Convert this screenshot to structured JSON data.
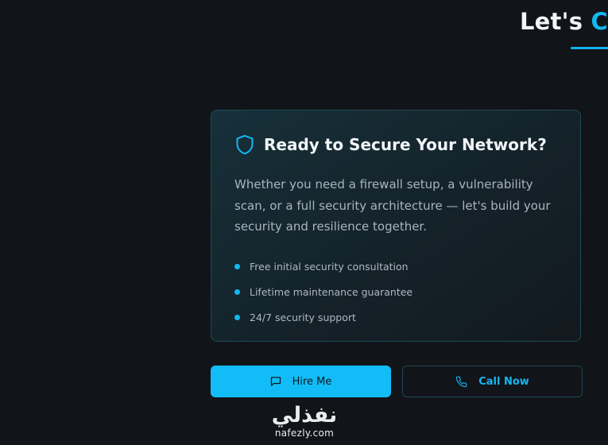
{
  "section": {
    "heading_part1": "Let's",
    "heading_part2": "Co"
  },
  "card": {
    "title": "Ready to Secure Your Network?",
    "icon": "shield-icon",
    "description": "Whether you need a firewall setup, a vulnerability scan, or a full security architecture — let's build your security and resilience together.",
    "features": [
      "Free initial security consultation",
      "Lifetime maintenance guarantee",
      "24/7 security support"
    ]
  },
  "buttons": {
    "hire_label": "Hire Me",
    "hire_icon": "message-square-icon",
    "call_label": "Call Now",
    "call_icon": "phone-icon"
  },
  "watermark": {
    "arabic": "نفذلي",
    "latin": "nafezly.com"
  },
  "colors": {
    "background": "#111419",
    "accent": "#12b8f0",
    "card_border": "#1e4a57",
    "hire_button": "#12bdf7"
  }
}
